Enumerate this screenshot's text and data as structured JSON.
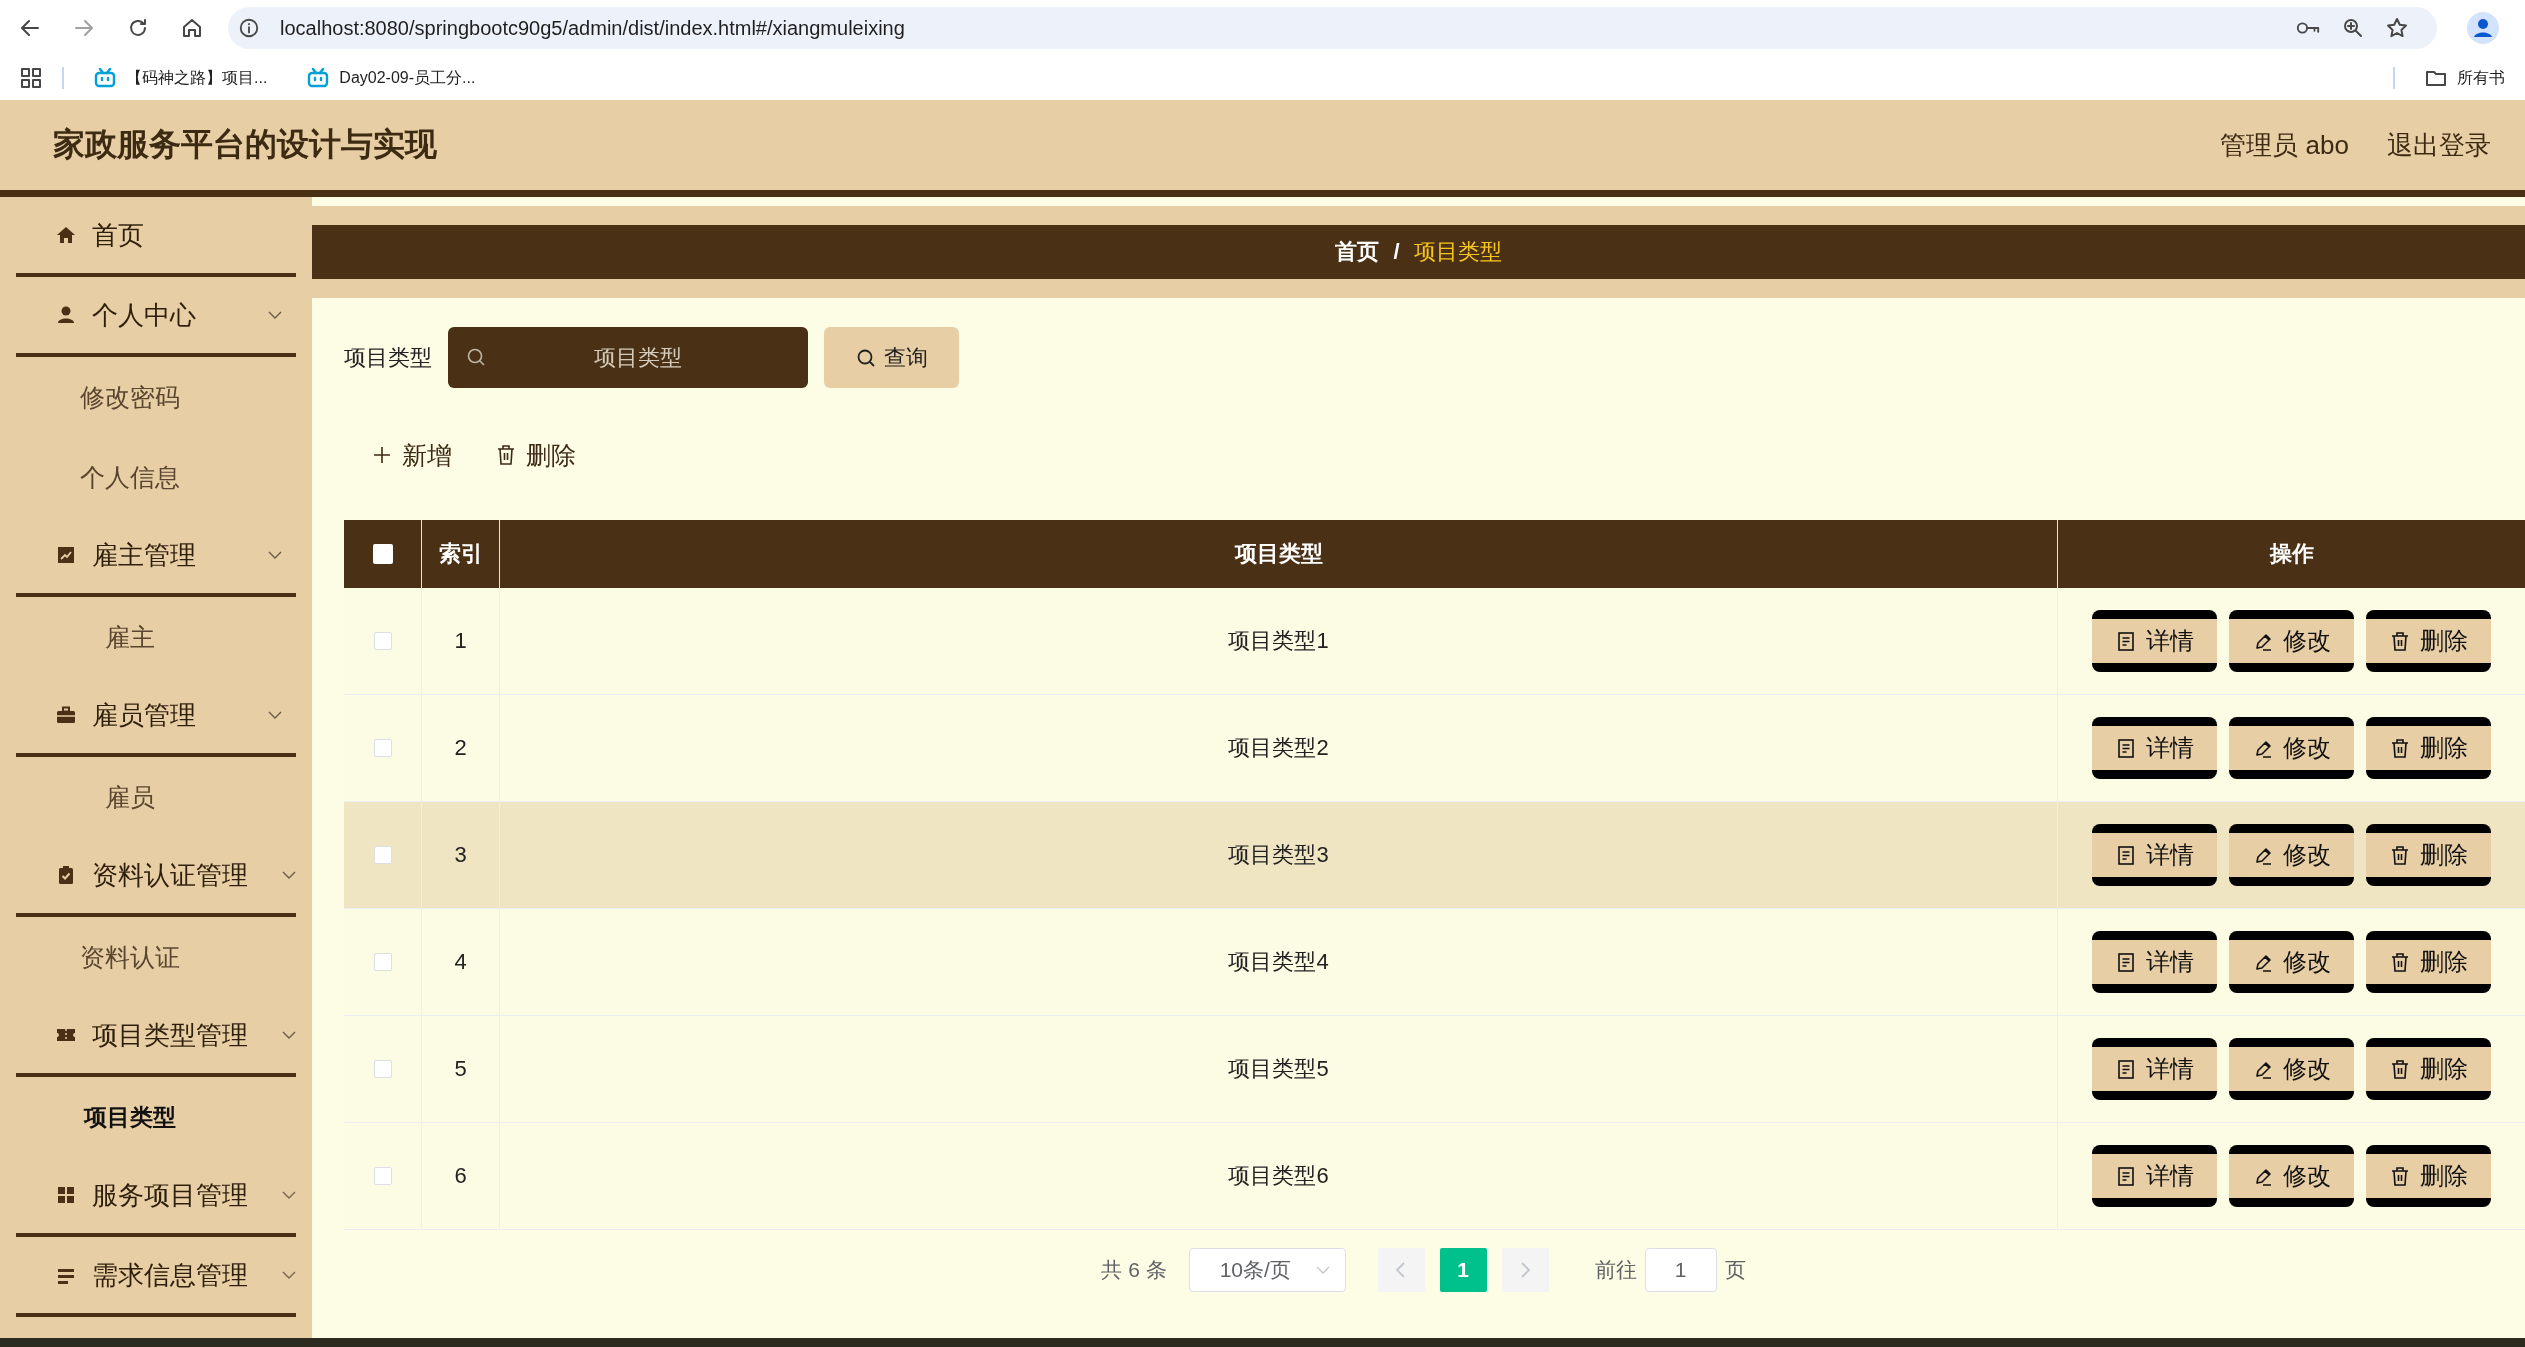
{
  "browser": {
    "url": "localhost:8080/springbootc90g5/admin/dist/index.html#/xiangmuleixing",
    "bookmarks": [
      {
        "label": "【码神之路】项目..."
      },
      {
        "label": "Day02-09-员工分..."
      }
    ],
    "all_bookmarks": "所有书"
  },
  "header": {
    "title": "家政服务平台的设计与实现",
    "user": "管理员 abo",
    "logout": "退出登录"
  },
  "sidebar": {
    "items": [
      {
        "label": "首页",
        "kind": "link"
      },
      {
        "label": "个人中心",
        "kind": "group",
        "expanded": true,
        "children": [
          {
            "label": "修改密码",
            "selected": false
          },
          {
            "label": "个人信息",
            "selected": false
          }
        ]
      },
      {
        "label": "雇主管理",
        "kind": "group",
        "expanded": true,
        "children": [
          {
            "label": "雇主",
            "selected": false
          }
        ]
      },
      {
        "label": "雇员管理",
        "kind": "group",
        "expanded": true,
        "children": [
          {
            "label": "雇员",
            "selected": false
          }
        ]
      },
      {
        "label": "资料认证管理",
        "kind": "group",
        "expanded": true,
        "children": [
          {
            "label": "资料认证",
            "selected": false
          }
        ]
      },
      {
        "label": "项目类型管理",
        "kind": "group",
        "expanded": true,
        "children": [
          {
            "label": "项目类型",
            "selected": true
          }
        ]
      },
      {
        "label": "服务项目管理",
        "kind": "group",
        "expanded": false
      },
      {
        "label": "需求信息管理",
        "kind": "group",
        "expanded": false
      }
    ]
  },
  "breadcrumb": {
    "separator": "/",
    "items": [
      {
        "label": "首页",
        "selected": false
      },
      {
        "label": "项目类型",
        "selected": true
      }
    ]
  },
  "search": {
    "label": "项目类型",
    "placeholder": "项目类型",
    "button": "查询"
  },
  "toolbar": {
    "add": "新增",
    "delete": "删除"
  },
  "table": {
    "select_all": {
      "checked": false
    },
    "columns": [
      "索引",
      "项目类型",
      "操作"
    ],
    "rows": [
      {
        "index": "1",
        "name": "项目类型1",
        "checked": false,
        "highlighted": false,
        "actions": [
          "详情",
          "修改",
          "删除"
        ]
      },
      {
        "index": "2",
        "name": "项目类型2",
        "checked": false,
        "highlighted": false,
        "actions": [
          "详情",
          "修改",
          "删除"
        ]
      },
      {
        "index": "3",
        "name": "项目类型3",
        "checked": false,
        "highlighted": true,
        "actions": [
          "详情",
          "修改",
          "删除"
        ]
      },
      {
        "index": "4",
        "name": "项目类型4",
        "checked": false,
        "highlighted": false,
        "actions": [
          "详情",
          "修改",
          "删除"
        ]
      },
      {
        "index": "5",
        "name": "项目类型5",
        "checked": false,
        "highlighted": false,
        "actions": [
          "详情",
          "修改",
          "删除"
        ]
      },
      {
        "index": "6",
        "name": "项目类型6",
        "checked": false,
        "highlighted": false,
        "actions": [
          "详情",
          "修改",
          "删除"
        ]
      }
    ]
  },
  "pagination": {
    "total": "共 6 条",
    "page_size": "10条/页",
    "pages": [
      {
        "label": "1",
        "selected": true
      }
    ],
    "goto_label": "前往",
    "goto_value": "1",
    "page_unit": "页"
  }
}
